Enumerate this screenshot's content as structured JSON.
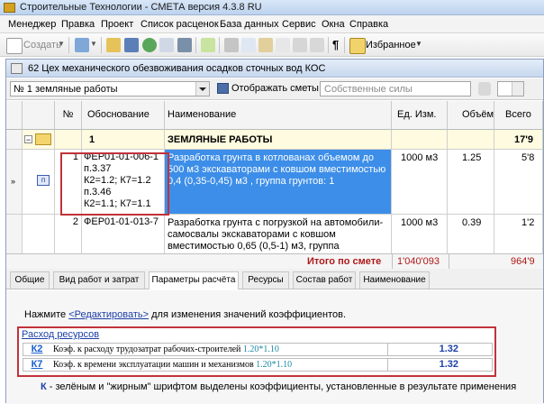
{
  "app": {
    "title": "Строительные Технологии - СМЕТА  версия 4.3.8 RU"
  },
  "menu": [
    "Менеджер",
    "Правка",
    "Проект",
    "Список расценок",
    "База данных",
    "Сервис",
    "Окна",
    "Справка"
  ],
  "toolbar": {
    "create_label": "Создать",
    "favorites_label": "Избранное"
  },
  "document": {
    "title": "62 Цех механического обезвоживания  осадков сточных вод КОС"
  },
  "filter": {
    "section_value": "№ 1 земляные работы",
    "show_estimates_label": "Отображать сметы",
    "own_forces_placeholder": "Собственные силы"
  },
  "grid": {
    "headers": {
      "num": "№",
      "basis": "Обоснование",
      "name": "Наименование",
      "unit": "Ед. Изм.",
      "volume": "Объём",
      "total": "Всего"
    },
    "section": {
      "num": "1",
      "name": "ЗЕМЛЯНЫЕ РАБОТЫ",
      "total": "17'9"
    },
    "rows": [
      {
        "num": "1",
        "basis_lines": [
          "ФЕР01-01-006-1",
          "п.3.37",
          "К2=1.2; К7=1.2",
          "п.3.46",
          "К2=1.1; К7=1.1"
        ],
        "name": "Разработка грунта в котлованах объемом до 500 м3 экскаваторами с ковшом вместимостью 0,4 (0,35-0,45) м3 , группа грунтов: 1",
        "unit": "1000 м3",
        "volume": "1.25",
        "total": "5'8"
      },
      {
        "num": "2",
        "basis_lines": [
          "ФЕР01-01-013-7"
        ],
        "name": "Разработка грунта с погрузкой на автомобили-самосвалы экскаваторами с ковшом вместимостью 0,65 (0,5-1) м3, группа",
        "unit": "1000 м3",
        "volume": "0.39",
        "total": "1'2"
      }
    ],
    "footer": {
      "label": "Итого по смете",
      "sum": "1'040'093",
      "total": "964'9"
    }
  },
  "tabs": [
    {
      "label": "Общие",
      "active": false
    },
    {
      "label": "Вид работ и затрат",
      "active": false
    },
    {
      "label": "Параметры расчёта",
      "active": true
    },
    {
      "label": "Ресурсы",
      "active": false
    },
    {
      "label": "Состав работ",
      "active": false
    },
    {
      "label": "Наименование",
      "active": false
    }
  ],
  "params": {
    "hint_before": "Нажмите ",
    "hint_link": "<Редактировать>",
    "hint_after": " для изменения значений коэффициентов.",
    "resources_header": "Расход ресурсов",
    "coefs": [
      {
        "code": "К2",
        "desc": "Коэф. к расходу трудозатрат рабочих-строителей ",
        "formula": "1.20*1.10",
        "value": "1.32"
      },
      {
        "code": "К7",
        "desc": "Коэф. к времени эксплуатации машин и механизмов ",
        "formula": "1.20*1.10",
        "value": "1.32"
      }
    ],
    "legend_k": "К",
    "legend_rest": " - зелёным и \"жирным\" шрифтом выделены коэффициенты, установленные в результате применения"
  },
  "colors": {
    "selection": "#3d8ee8",
    "highlight_border": "#c2323a",
    "link": "#1d3fa8",
    "footer_red": "#b01818"
  }
}
